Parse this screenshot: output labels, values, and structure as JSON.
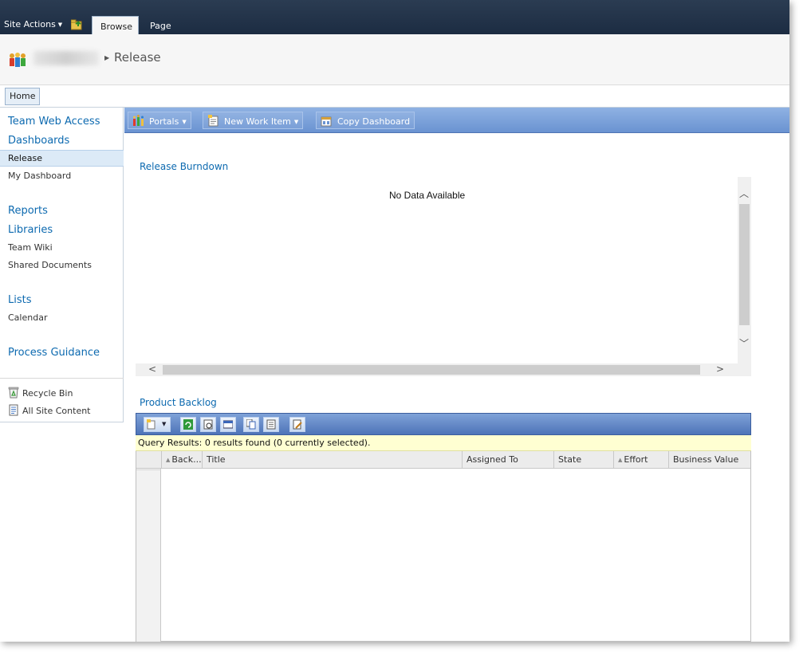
{
  "ribbon": {
    "site_actions": "Site Actions",
    "tabs": [
      {
        "label": "Browse",
        "active": true
      },
      {
        "label": "Page",
        "active": false
      }
    ]
  },
  "header": {
    "breadcrumb_current": "Release"
  },
  "topnav": {
    "home": "Home"
  },
  "quicklaunch": {
    "team_web_access": "Team Web Access",
    "dashboards": "Dashboards",
    "dashboard_items": [
      "Release",
      "My Dashboard"
    ],
    "reports": "Reports",
    "libraries": "Libraries",
    "library_items": [
      "Team Wiki",
      "Shared Documents"
    ],
    "lists": "Lists",
    "list_items": [
      "Calendar"
    ],
    "process_guidance": "Process Guidance",
    "recycle_bin": "Recycle Bin",
    "all_site_content": "All Site Content"
  },
  "toolbar": {
    "portals": "Portals",
    "new_work_item": "New Work Item",
    "copy_dashboard": "Copy Dashboard"
  },
  "burndown": {
    "title": "Release Burndown",
    "no_data": "No Data Available"
  },
  "backlog": {
    "title": "Product Backlog",
    "query_results": "Query Results: 0 results found (0 currently selected).",
    "columns": [
      "Back...",
      "Title",
      "Assigned To",
      "State",
      "Effort",
      "Business Value"
    ]
  },
  "colors": {
    "ribbon_dark": "#1c2c42",
    "link_blue": "#0d6ab0",
    "toolbar_blue": "#6a93d1",
    "query_yellow": "#ffffd2"
  }
}
